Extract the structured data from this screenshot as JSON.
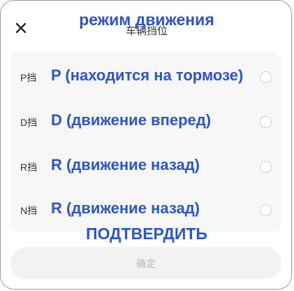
{
  "dialog": {
    "title_original": "车辆挡位",
    "title_translation": "режим движения",
    "close_icon": "close-icon"
  },
  "gear_options": [
    {
      "original": "P挡",
      "translation": "P (находится на тормозе)",
      "selected": false
    },
    {
      "original": "D挡",
      "translation": "D (движение вперед)",
      "selected": false
    },
    {
      "original": "R挡",
      "translation": "R (движение назад)",
      "selected": false
    },
    {
      "original": "N挡",
      "translation": "R (движение назад)",
      "selected": false
    }
  ],
  "confirm": {
    "label_original": "确定",
    "label_translation": "ПОДТВЕРДИТЬ"
  },
  "colors": {
    "translation_text": "#2b56c6",
    "panel_background": "#f7f7f7",
    "button_background": "#f2f2f2",
    "button_text": "#b8b8b8"
  }
}
